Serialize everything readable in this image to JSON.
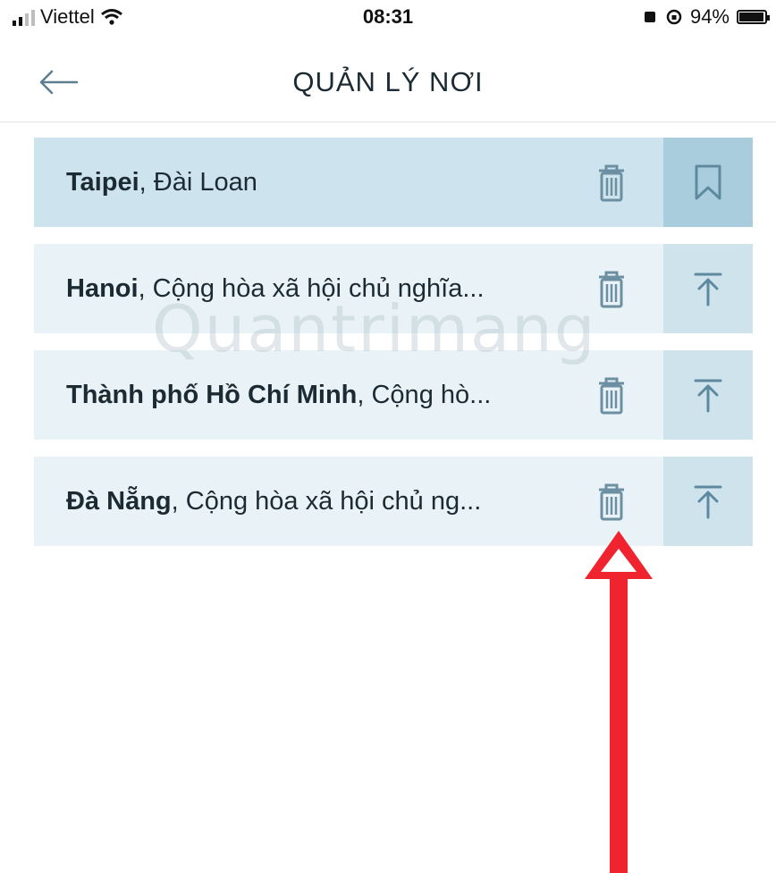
{
  "status_bar": {
    "carrier": "Viettel",
    "time": "08:31",
    "battery": "94%",
    "battery_level": 0.94
  },
  "header": {
    "back_icon": "arrow-left-icon",
    "title": "QUẢN LÝ NƠI"
  },
  "places": [
    {
      "name": "Taipei",
      "detail": ", Đài Loan",
      "active": true,
      "side_icon": "bookmark-icon"
    },
    {
      "name": "Hanoi",
      "detail": ", Cộng hòa xã hội chủ nghĩa...",
      "active": false,
      "side_icon": "move-to-top-icon"
    },
    {
      "name": "Thành phố Hồ Chí Minh",
      "detail": ", Cộng hò...",
      "active": false,
      "side_icon": "move-to-top-icon"
    },
    {
      "name": "Đà Nẵng",
      "detail": ", Cộng hòa xã hội chủ ng...",
      "active": false,
      "side_icon": "move-to-top-icon"
    }
  ],
  "watermark": "Quantrimang",
  "colors": {
    "row_bg": "#e9f3f7",
    "row_active_bg": "#cde3ed",
    "side_bg": "#cfe3ec",
    "side_active_bg": "#a9cddd",
    "icon": "#6c8fa2",
    "annotation_arrow": "#f0242e"
  }
}
